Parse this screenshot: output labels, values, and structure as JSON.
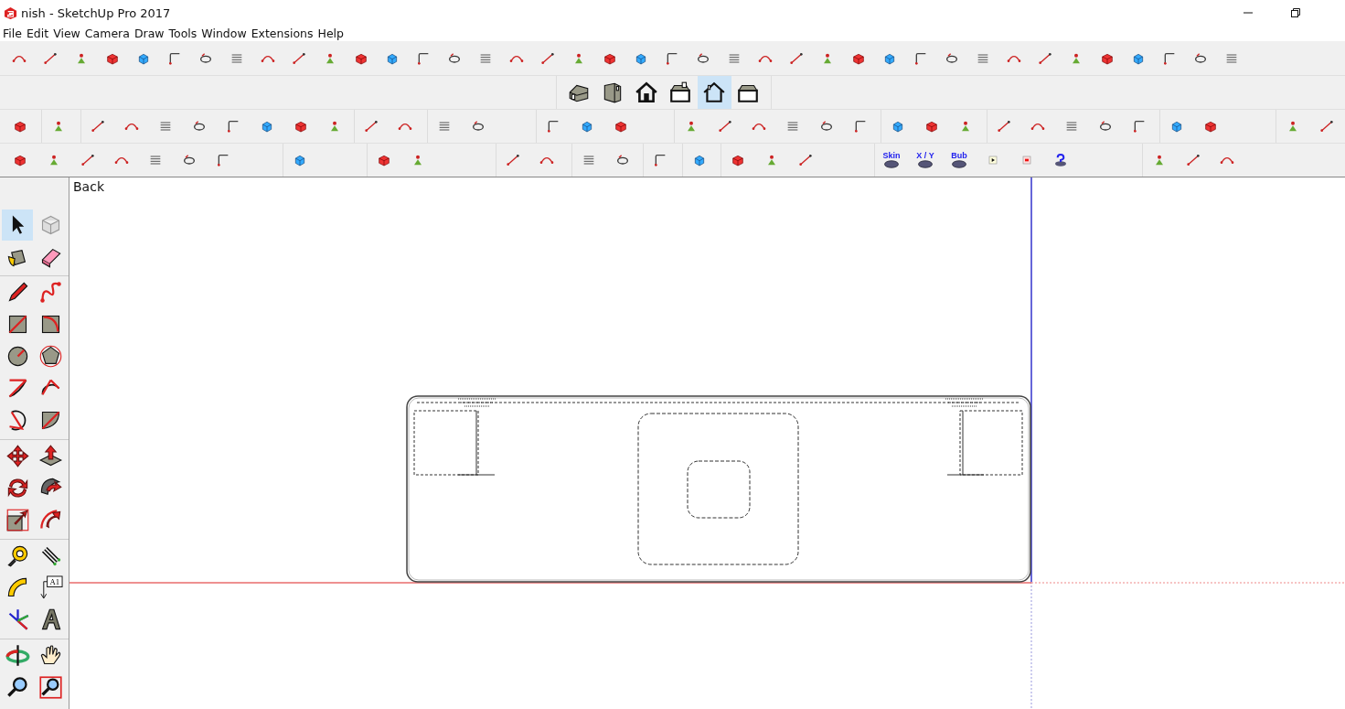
{
  "window": {
    "title": "nish - SketchUp Pro 2017"
  },
  "menu": [
    {
      "label": "File"
    },
    {
      "label": "Edit"
    },
    {
      "label": "View"
    },
    {
      "label": "Camera"
    },
    {
      "label": "Draw"
    },
    {
      "label": "Tools"
    },
    {
      "label": "Window"
    },
    {
      "label": "Extensions"
    },
    {
      "label": "Help"
    }
  ],
  "view_buttons": [
    {
      "selected": false
    },
    {
      "selected": false
    },
    {
      "selected": false
    },
    {
      "selected": false
    },
    {
      "selected": true
    },
    {
      "selected": false
    }
  ],
  "labeled_tools": [
    {
      "label": "Skin"
    },
    {
      "label": "X / Y"
    },
    {
      "label": "Bub"
    }
  ],
  "tool_palette": {
    "text_tool_label": "A1",
    "tools": [
      {
        "selected": true
      },
      {
        "selected": false
      },
      {
        "selected": false
      },
      {
        "selected": false
      },
      {
        "selected": false
      },
      {
        "selected": false
      },
      {
        "selected": false
      },
      {
        "selected": false
      },
      {
        "selected": false
      },
      {
        "selected": false
      },
      {
        "selected": false
      },
      {
        "selected": false
      },
      {
        "selected": false
      },
      {
        "selected": false
      },
      {
        "selected": false
      },
      {
        "selected": false
      },
      {
        "selected": false
      },
      {
        "selected": false
      },
      {
        "selected": false
      },
      {
        "selected": false
      },
      {
        "selected": false
      },
      {
        "selected": false
      },
      {
        "selected": false
      },
      {
        "selected": false
      },
      {
        "selected": false
      },
      {
        "selected": false
      },
      {
        "selected": false
      },
      {
        "selected": false
      },
      {
        "selected": false
      },
      {
        "selected": false
      }
    ]
  },
  "viewport": {
    "view_label": "Back"
  }
}
